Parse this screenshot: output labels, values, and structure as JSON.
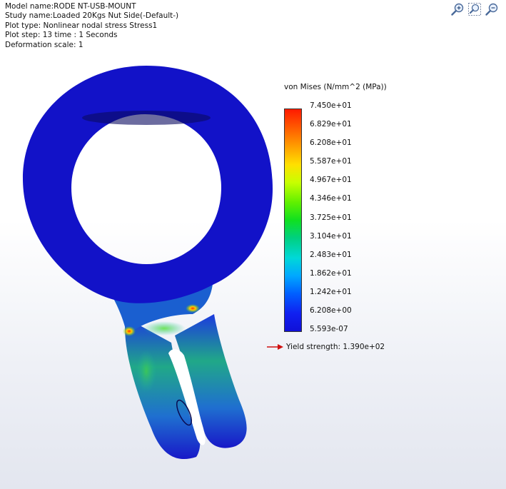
{
  "info": {
    "model_name": "Model name:RODE NT-USB-MOUNT",
    "study_name": "Study name:Loaded 20Kgs Nut Side(-Default-)",
    "plot_type": "Plot type: Nonlinear nodal stress Stress1",
    "plot_step": "Plot step: 13   time : 1 Seconds",
    "deformation": "Deformation scale: 1"
  },
  "toolbar": [
    "zoom-in-icon",
    "zoom-fit-icon",
    "zoom-out-icon"
  ],
  "legend": {
    "title": "von Mises (N/mm^2 (MPa))",
    "ticks": [
      "7.450e+01",
      "6.829e+01",
      "6.208e+01",
      "5.587e+01",
      "4.967e+01",
      "4.346e+01",
      "3.725e+01",
      "3.104e+01",
      "2.483e+01",
      "1.862e+01",
      "1.242e+01",
      "6.208e+00",
      "5.593e-07"
    ],
    "yield_text": "Yield strength: 1.390e+02"
  },
  "colors": {
    "part": "#1212c8",
    "hot": "#ff2a00",
    "arrow": "#d01010"
  }
}
